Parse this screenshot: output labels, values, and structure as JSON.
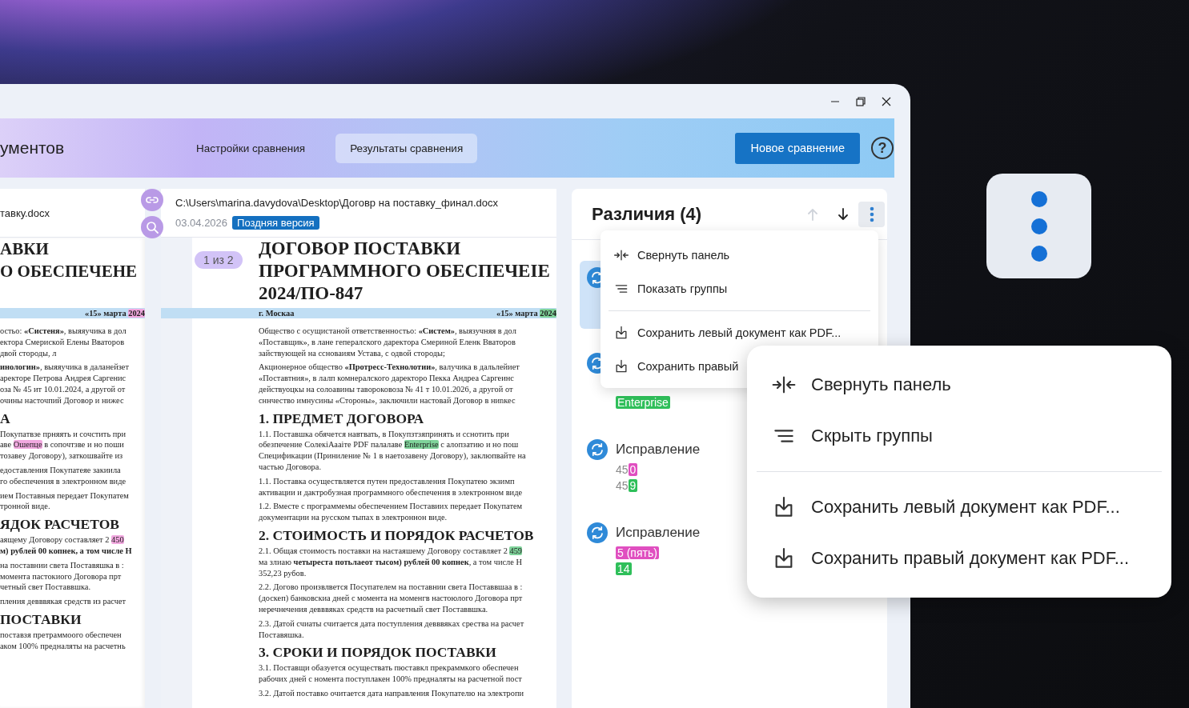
{
  "header": {
    "title": "ументов",
    "tabs": [
      {
        "label": "Настройки сравнения",
        "selected": false
      },
      {
        "label": "Результаты сравнения",
        "selected": true
      }
    ],
    "new_button": "Новое сравнение",
    "help_label": "?"
  },
  "left_document": {
    "file_name": "тавку.docx",
    "blocks": [
      {
        "kind": "title",
        "lines": [
          "АВКИ",
          "О ОБЕСПЕЧЕНЕ"
        ]
      },
      {
        "kind": "dateline",
        "current": true,
        "right": [
          {
            "text": "«15» марта "
          },
          {
            "text": "2024",
            "color": "#f1a8df"
          }
        ]
      },
      {
        "kind": "para",
        "lines": [
          "остьо: **«Систеня»**, выяяучика в дол",
          "ектора Смериской Елены Вваторов",
          "двой стороды, л"
        ]
      },
      {
        "kind": "para",
        "lines": [
          "**инологин»**, выяяучика в даланейзет",
          "аректоре Петрова Андрея Сaргенис",
          "оза № 45 ит 10.01.2024, а другой от",
          "очины насточпий Договор и нижес"
        ]
      },
      {
        "kind": "heading",
        "lines": [
          "А"
        ]
      },
      {
        "kind": "para",
        "lines": [
          "Покупатвзе прняять и сочстить при",
          [
            {
              "text": "аве "
            },
            {
              "text": "Ошепце",
              "color": "#f1a8df"
            },
            {
              "text": " в сопочтзве и но поши"
            }
          ],
          "тозавeу Договору), заткошвайте из"
        ]
      },
      {
        "kind": "para",
        "lines": [
          "едоставления Покупатеяe закиила",
          "го обеспечения в электронном виде"
        ]
      },
      {
        "kind": "para",
        "lines": [
          "ием Поставныя передает Покупатем",
          "тронной виде."
        ]
      },
      {
        "kind": "heading",
        "lines": [
          "ЯДОК РАСЧЕТОВ"
        ]
      },
      {
        "kind": "para",
        "lines": [
          [
            {
              "text": "аящему Договору составляет 2 "
            },
            {
              "text": "450",
              "color": "#f1a8df"
            }
          ],
          "**м) рублей 00 копнек, а том числе Н**"
        ]
      },
      {
        "kind": "para",
        "lines": [
          "на поставнии света Поставяшка в :",
          "момента пастокиого Договора прт",
          "четный свет Поставвшка."
        ]
      },
      {
        "kind": "para",
        "lines": [
          "пления девввякая средств из расчет"
        ]
      },
      {
        "kind": "heading",
        "lines": [
          "ПОСТАВКИ"
        ]
      },
      {
        "kind": "para",
        "lines": [
          "поставзя претраммоого обеспечен",
          "аком 100% предналяты на расчетнь"
        ]
      }
    ]
  },
  "right_document": {
    "file_name": "C:\\Users\\marina.davydova\\Desktop\\Договр на поставку_финал.docx",
    "date": "03.04.2026",
    "version_badge": "Поздняя версия",
    "page_indicator": "1 из 2",
    "blocks": [
      {
        "kind": "title",
        "lines": [
          "ДОГОВОР ПОСТАВКИ",
          "ПРОГРАММНОГО ОБЕСПЕЧЕIE",
          "2024/ПО-847"
        ]
      },
      {
        "kind": "dateline",
        "current": true,
        "left": [
          {
            "text": "г. Москаа"
          }
        ],
        "right": [
          {
            "text": "«15» марта "
          },
          {
            "text": "2024",
            "color": "#7fd39a"
          }
        ]
      },
      {
        "kind": "para",
        "lines": [
          "Общество с осущистаной ответственностьо: **«Систем»**, выязучняя в дол",
          "«Поставщик», в лане гепералского даректора Смериной Еленк Вваторов",
          "зайствующей на ссноваиям Устава, с одвой стороды;"
        ]
      },
      {
        "kind": "para",
        "lines": [
          "Акционерное общество **«Протресс-Технолотии»**, валучика в дальлейиет",
          "«Поставтния», в лалп комнералского даректоро Пекка Андреа Сaргеинс",
          "действуоцкы на солоавины тавороковоза № 41 т 10.01.2026, а другой от",
          "сннчество имнуcины «Стороны», заключили настовай Договор в ниnкес"
        ]
      },
      {
        "kind": "heading",
        "lines": [
          "1. ПРЕДМЕТ ДОГОВОРА"
        ]
      },
      {
        "kind": "para",
        "lines": [
          "1.1. Поставшка обячется навтвать, в Покупзтзяпринять и сснотить при",
          [
            {
              "text": "обезпечение СолекiАааiте PDF палалаве "
            },
            {
              "text": "Enterprise",
              "color": "#7fd39a"
            },
            {
              "text": " с алопзатию и но пош"
            }
          ],
          "Спецификации (Принилeние № 1 в наетозавeну Договору), заклюпвайте на",
          "частью Договора."
        ]
      },
      {
        "kind": "para",
        "lines": [
          "1.1. Поставка осуществляется путен предоставления Покупатею экзимп",
          "активации и дактробузная программного обеспечения в электронном виде"
        ]
      },
      {
        "kind": "para",
        "lines": [
          "1.2. Вместе с программемы обеспечением Поставиих передает Покупатем",
          "документации на русском тыпах в электроннон виде."
        ]
      },
      {
        "kind": "heading",
        "lines": [
          "2. СТОИМОСТЬ И ПОРЯДОК РАСЧЕТОВ"
        ]
      },
      {
        "kind": "para",
        "lines": [
          [
            {
              "text": "2.1. Общая стоимость поставки на настаяшему Договору составляет 2 "
            },
            {
              "text": "459",
              "color": "#7fd39a"
            }
          ],
          "ма злиаю **четыреста потьлаеот тысом) рублей 00 копнек**, а том числе Н",
          "352,23 рубов."
        ]
      },
      {
        "kind": "para",
        "lines": [
          "2.2. Догово произвлвется Посупателем на поставнии света Поставвшаа в :",
          "(доскеп) банковскиа дней с момента на моменгв настоюлого Договора прт",
          "неречнечения девввякaх средств на расчетный свет Поставвшка."
        ]
      },
      {
        "kind": "para",
        "lines": [
          "2.3. Датой счиаты считается дата поступления девввякaх срества на расчет",
          "Поставяшка."
        ]
      },
      {
        "kind": "heading",
        "lines": [
          "3. СРОКИ И ПОРЯДОК ПОСТАВКИ"
        ]
      },
      {
        "kind": "para",
        "lines": [
          "3.1. Поставщи обазуется осуществать пюставкл прекраммкого обеспечен",
          "рабочих дней с номента поступлакен 100% предналяты на расчетной пост"
        ]
      },
      {
        "kind": "para",
        "lines": [
          "3.2. Датой поставко очитается дата направления Покупателю на электропи"
        ]
      }
    ]
  },
  "differences": {
    "title": "Различия (4)",
    "nav": [
      {
        "kind": "up",
        "disabled": true
      },
      {
        "kind": "down",
        "disabled": false
      }
    ],
    "menu_open": true,
    "items": [
      {
        "selected": true
      },
      {
        "selected": false,
        "values": [
          [
            {
              "text": "Enterprise",
              "color": "#2fbf5a"
            }
          ]
        ]
      },
      {
        "selected": false,
        "label": "Исправление",
        "values": [
          [
            {
              "text": "45"
            },
            {
              "text": "0",
              "color": "#e04fc0"
            }
          ],
          [
            {
              "text": "45"
            },
            {
              "text": "9",
              "color": "#2fbf5a"
            }
          ]
        ]
      },
      {
        "selected": false,
        "label": "Исправление",
        "values": [
          [
            {
              "text": "5 (пять)",
              "color": "#e04fc0"
            }
          ],
          [
            {
              "text": "14",
              "color": "#2fbf5a"
            }
          ]
        ]
      }
    ]
  },
  "panel_menu": {
    "items": [
      {
        "kind": "collapse",
        "label": "Свернуть панель"
      },
      {
        "kind": "groups",
        "label": "Показать группы"
      },
      {
        "kind": "divider"
      },
      {
        "kind": "save",
        "label": "Сохранить левый документ как PDF..."
      },
      {
        "kind": "save",
        "label": "Сохранить правый"
      }
    ]
  },
  "zoomed_menu": {
    "items": [
      {
        "kind": "collapse",
        "label": "Свернуть панель"
      },
      {
        "kind": "groups",
        "label": "Скрыть группы"
      },
      {
        "kind": "divider"
      },
      {
        "kind": "save",
        "label": "Сохранить левый документ как PDF..."
      },
      {
        "kind": "save",
        "label": "Сохранить правый документ как PDF..."
      }
    ]
  }
}
